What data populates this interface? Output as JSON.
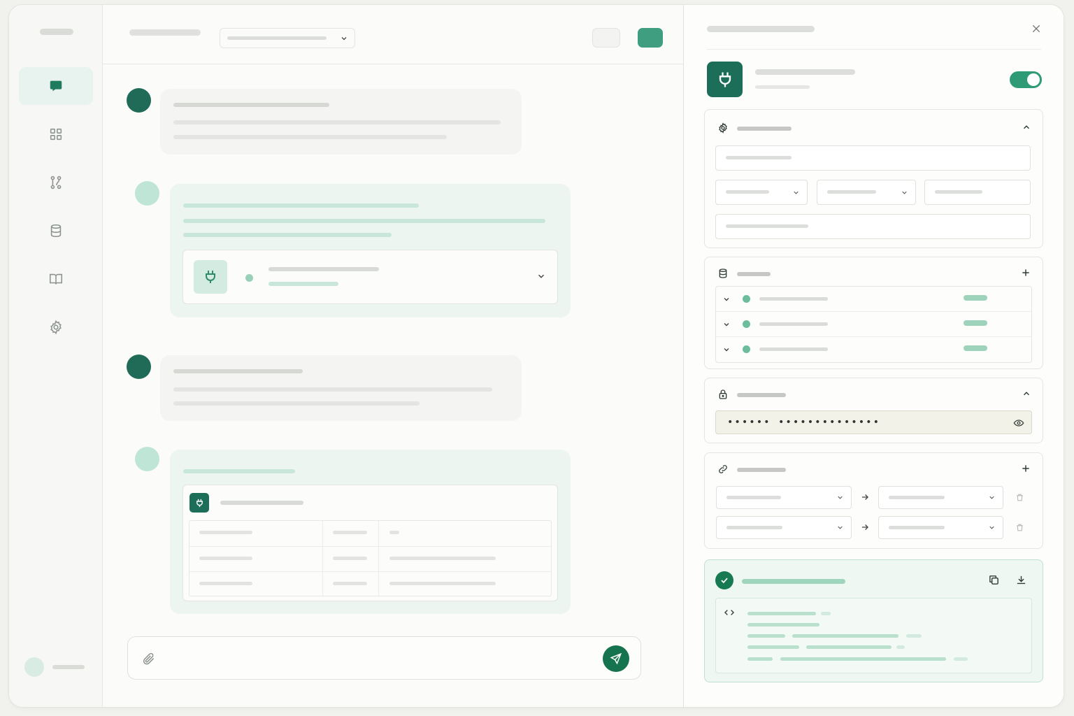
{
  "colors": {
    "accent": "#1f7a5e",
    "accent_light": "#3f9e80",
    "send_button": "#15744f",
    "toggle_on": "#2f9a76",
    "success_bg": "#eef7f2"
  },
  "sidebar": {
    "items": [
      {
        "icon": "chat-bubble-icon",
        "active": true
      },
      {
        "icon": "grid-icon",
        "active": false
      },
      {
        "icon": "workflow-icon",
        "active": false
      },
      {
        "icon": "database-icon",
        "active": false
      },
      {
        "icon": "book-icon",
        "active": false
      },
      {
        "icon": "gear-icon",
        "active": false
      }
    ]
  },
  "topbar": {
    "model_select_icon": "chevron-down-icon"
  },
  "chat": {
    "tool_call": {
      "icon": "plug-icon",
      "expand_icon": "chevron-down-icon"
    },
    "tool_result": {
      "icon": "plug-icon"
    },
    "composer": {
      "attach_icon": "paperclip-icon",
      "send_icon": "send-icon"
    }
  },
  "panel": {
    "close_icon": "close-icon",
    "plugin_icon": "plug-icon",
    "enabled": true,
    "sections": {
      "settings": {
        "icon": "gear-icon",
        "action_icon": "chevron-up-icon"
      },
      "datasources": {
        "icon": "database-icon",
        "action_icon": "plus-icon",
        "rows": 3
      },
      "auth": {
        "icon": "lock-icon",
        "action_icon": "chevron-up-icon",
        "secret_mask": "•••••• ••••••••••••••",
        "reveal_icon": "eye-icon"
      },
      "mappings": {
        "icon": "link-icon",
        "action_icon": "plus-icon",
        "rows": 2
      },
      "result": {
        "status_icon": "check-icon",
        "copy_icon": "copy-icon",
        "download_icon": "download-icon",
        "code_icon": "code-icon"
      }
    }
  }
}
